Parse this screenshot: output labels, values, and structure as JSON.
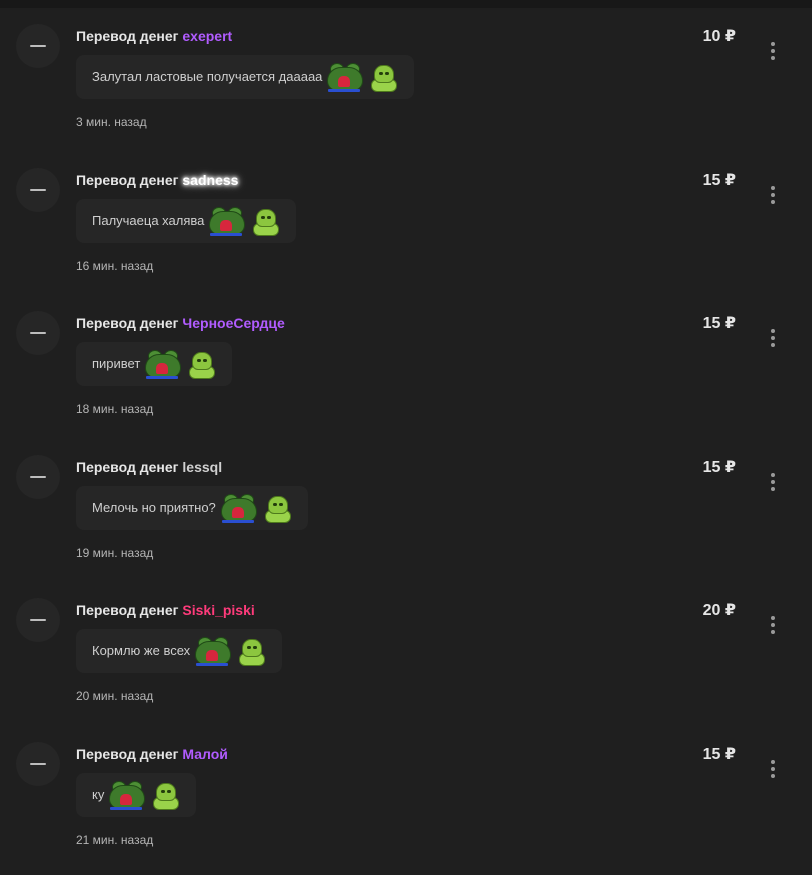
{
  "feed": {
    "items": [
      {
        "label": "Перевод денег",
        "user": "exepert",
        "user_color": "#b15cff",
        "user_glow": false,
        "message": "Залутал ластовые получается даааaa",
        "amount": "10 ₽",
        "time": "3 мин. назад",
        "emotes": [
          "frog-heart-emote",
          "green-blob-emote"
        ]
      },
      {
        "label": "Перевод денег",
        "user": "sadness",
        "user_color": "#ffffff",
        "user_glow": true,
        "message": "Палучаеца халява",
        "amount": "15 ₽",
        "time": "16 мин. назад",
        "emotes": [
          "frog-heart-emote",
          "green-blob-emote"
        ]
      },
      {
        "label": "Перевод денег",
        "user": "ЧерноеСердце",
        "user_color": "#b15cff",
        "user_glow": false,
        "message": "пиривет",
        "amount": "15 ₽",
        "time": "18 мин. назад",
        "emotes": [
          "frog-heart-emote",
          "green-blob-emote"
        ]
      },
      {
        "label": "Перевод денег",
        "user": "lessql",
        "user_color": "#d0d0d0",
        "user_glow": false,
        "message": "Мелочь но приятно?",
        "amount": "15 ₽",
        "time": "19 мин. назад",
        "emotes": [
          "frog-heart-emote",
          "green-blob-emote"
        ]
      },
      {
        "label": "Перевод денег",
        "user": "Siski_piski",
        "user_color": "#ff3b7b",
        "user_glow": false,
        "message": "Кормлю же всех",
        "amount": "20 ₽",
        "time": "20 мин. назад",
        "emotes": [
          "frog-heart-emote",
          "green-blob-emote"
        ]
      },
      {
        "label": "Перевод денег",
        "user": "Малой",
        "user_color": "#b15cff",
        "user_glow": false,
        "message": "ку",
        "amount": "15 ₽",
        "time": "21 мин. назад",
        "emotes": [
          "frog-heart-emote",
          "green-blob-emote"
        ]
      }
    ]
  },
  "icons": {
    "avatar": "minus-avatar-icon",
    "more": "more-vertical-icon"
  }
}
